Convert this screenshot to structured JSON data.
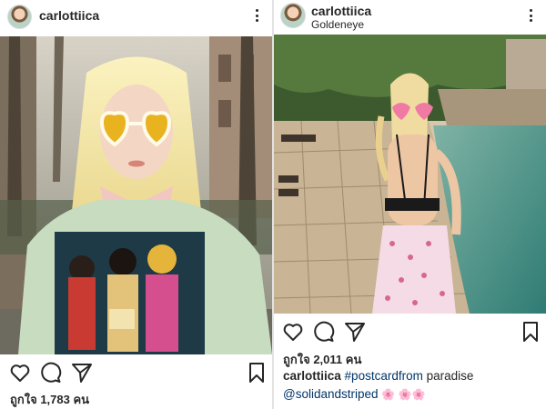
{
  "posts": [
    {
      "username": "carlottiica",
      "likes": "ถูกใจ 1,783 คน"
    },
    {
      "username": "carlottiica",
      "location": "Goldeneye",
      "likes": "ถูกใจ 2,011 คน",
      "caption": {
        "user": "carlottiica",
        "hashtag1": "#postcardfrom",
        "text": "paradise",
        "mention": "@solidandstriped",
        "emoji": "🌸 🌸🌸"
      }
    }
  ],
  "icons": [
    "more-options-icon",
    "heart-icon",
    "comment-icon",
    "share-icon",
    "bookmark-icon"
  ],
  "colors": {
    "text": "#262626",
    "link": "#003569",
    "divider": "#e3e3e3"
  }
}
